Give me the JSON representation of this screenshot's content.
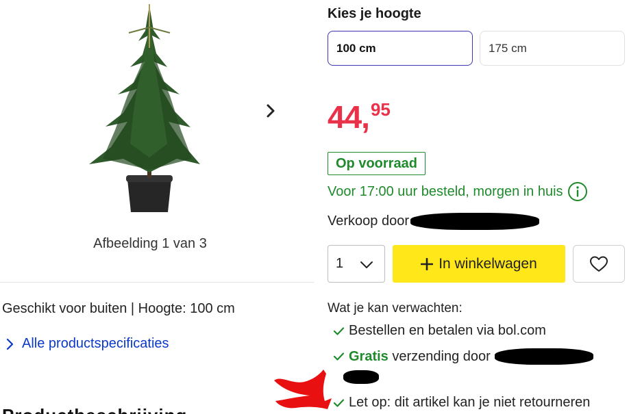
{
  "gallery": {
    "counter": "Afbeelding 1 van 3",
    "next_icon": "chevron-right-icon"
  },
  "product": {
    "subtitle": "Geschikt voor buiten | Hoogte: 100 cm",
    "specs_link": "Alle productspecificaties",
    "section_heading_partial": "Productbeschrijving"
  },
  "height": {
    "title": "Kies je hoogte",
    "options": [
      {
        "label": "100 cm",
        "selected": true
      },
      {
        "label": "175 cm",
        "selected": false
      }
    ]
  },
  "price": {
    "euros": "44",
    "separator": ",",
    "cents": "95"
  },
  "stock": {
    "badge": "Op voorraad",
    "delivery": "Voor 17:00 uur besteld, morgen in huis"
  },
  "seller": {
    "label": "Verkoop door"
  },
  "buy": {
    "quantity": "1",
    "add_to_cart": "In winkelwagen",
    "favorite_icon": "heart-icon"
  },
  "expectations": {
    "title": "Wat je kan verwachten:",
    "items": [
      {
        "text": "Bestellen en betalen via bol.com"
      },
      {
        "highlight": "Gratis",
        "text": "verzending door"
      },
      {
        "text": "Let op: dit artikel kan je niet retourneren"
      }
    ]
  },
  "colors": {
    "price": "#e9324a",
    "accent_green": "#1f8a2b",
    "cart_yellow": "#ffe71a",
    "link_blue": "#0a39c8",
    "selected_border": "#3e34b3",
    "annotation_red": "#e81010"
  }
}
